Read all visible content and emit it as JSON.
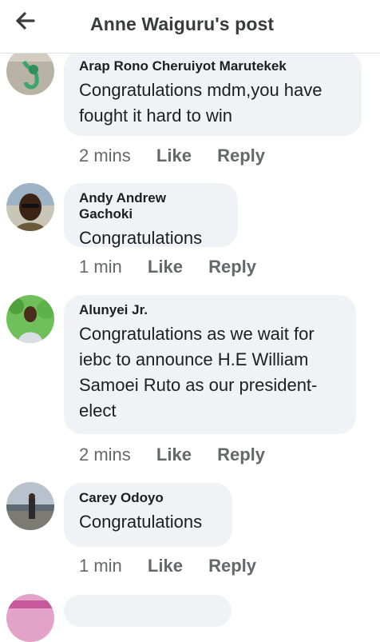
{
  "header": {
    "title": "Anne Waiguru's post",
    "back_icon": "arrow-left-icon"
  },
  "comments": [
    {
      "author": "Arap Rono Cheruiyot Marutekek",
      "text": "Congratulations mdm,you have fought it hard to win",
      "time": "2 mins",
      "like": "Like",
      "reply": "Reply"
    },
    {
      "author": "Andy Andrew Gachoki",
      "text": "Congratulations",
      "time": "1 min",
      "like": "Like",
      "reply": "Reply"
    },
    {
      "author": "Alunyei Jr.",
      "text": "Congratulations as we wait for iebc to announce H.E William Samoei Ruto as our president-elect",
      "time": "2 mins",
      "like": "Like",
      "reply": "Reply"
    },
    {
      "author": "Carey Odoyo",
      "text": "Congratulations",
      "time": "1 min",
      "like": "Like",
      "reply": "Reply"
    }
  ],
  "colors": {
    "bubble": "#f0f2f5",
    "meta": "#65676b",
    "text": "#1c1e21"
  }
}
